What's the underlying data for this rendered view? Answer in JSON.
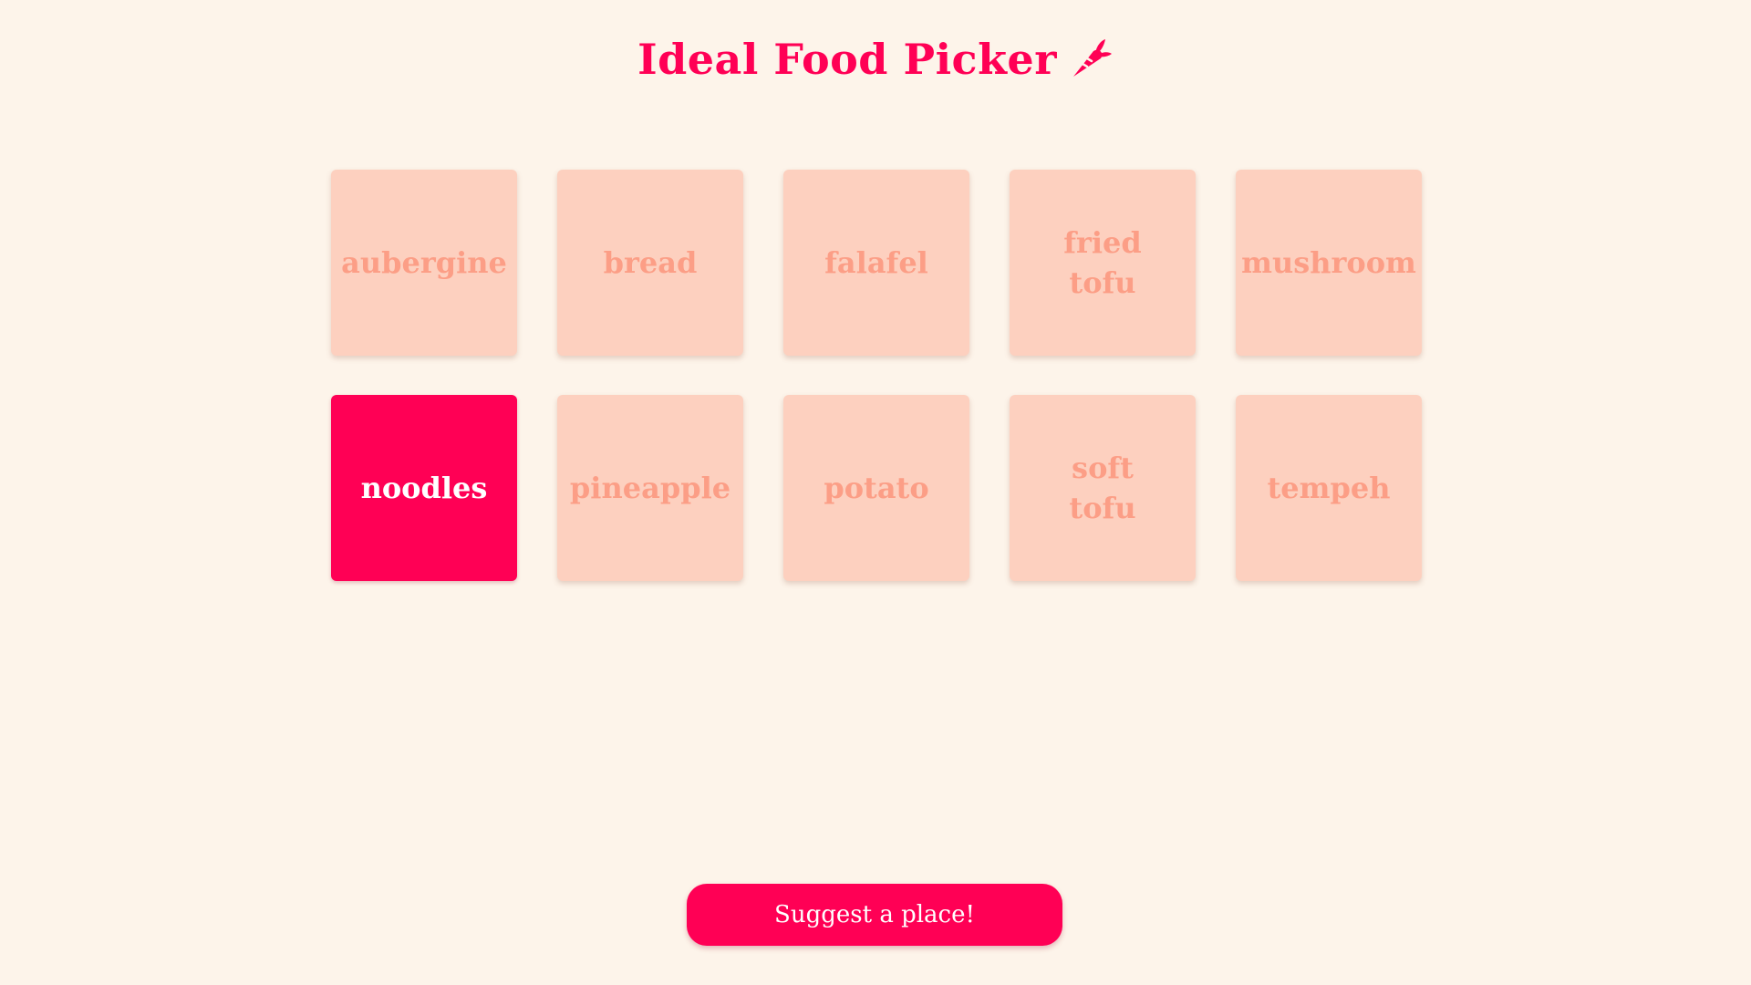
{
  "header": {
    "title": "Ideal Food Picker",
    "icon": "carrot-icon"
  },
  "colors": {
    "background": "#fdf4ea",
    "accent": "#ff0055",
    "card": "#fdd0bf",
    "card_text": "#fc9e86",
    "selected_text": "#ffffff"
  },
  "foods": [
    {
      "label": "aubergine",
      "selected": false
    },
    {
      "label": "bread",
      "selected": false
    },
    {
      "label": "falafel",
      "selected": false
    },
    {
      "label": "fried\ntofu",
      "selected": false
    },
    {
      "label": "mushroom",
      "selected": false
    },
    {
      "label": "noodles",
      "selected": true
    },
    {
      "label": "pineapple",
      "selected": false
    },
    {
      "label": "potato",
      "selected": false
    },
    {
      "label": "soft\ntofu",
      "selected": false
    },
    {
      "label": "tempeh",
      "selected": false
    }
  ],
  "actions": {
    "suggest_label": "Suggest a place!"
  }
}
